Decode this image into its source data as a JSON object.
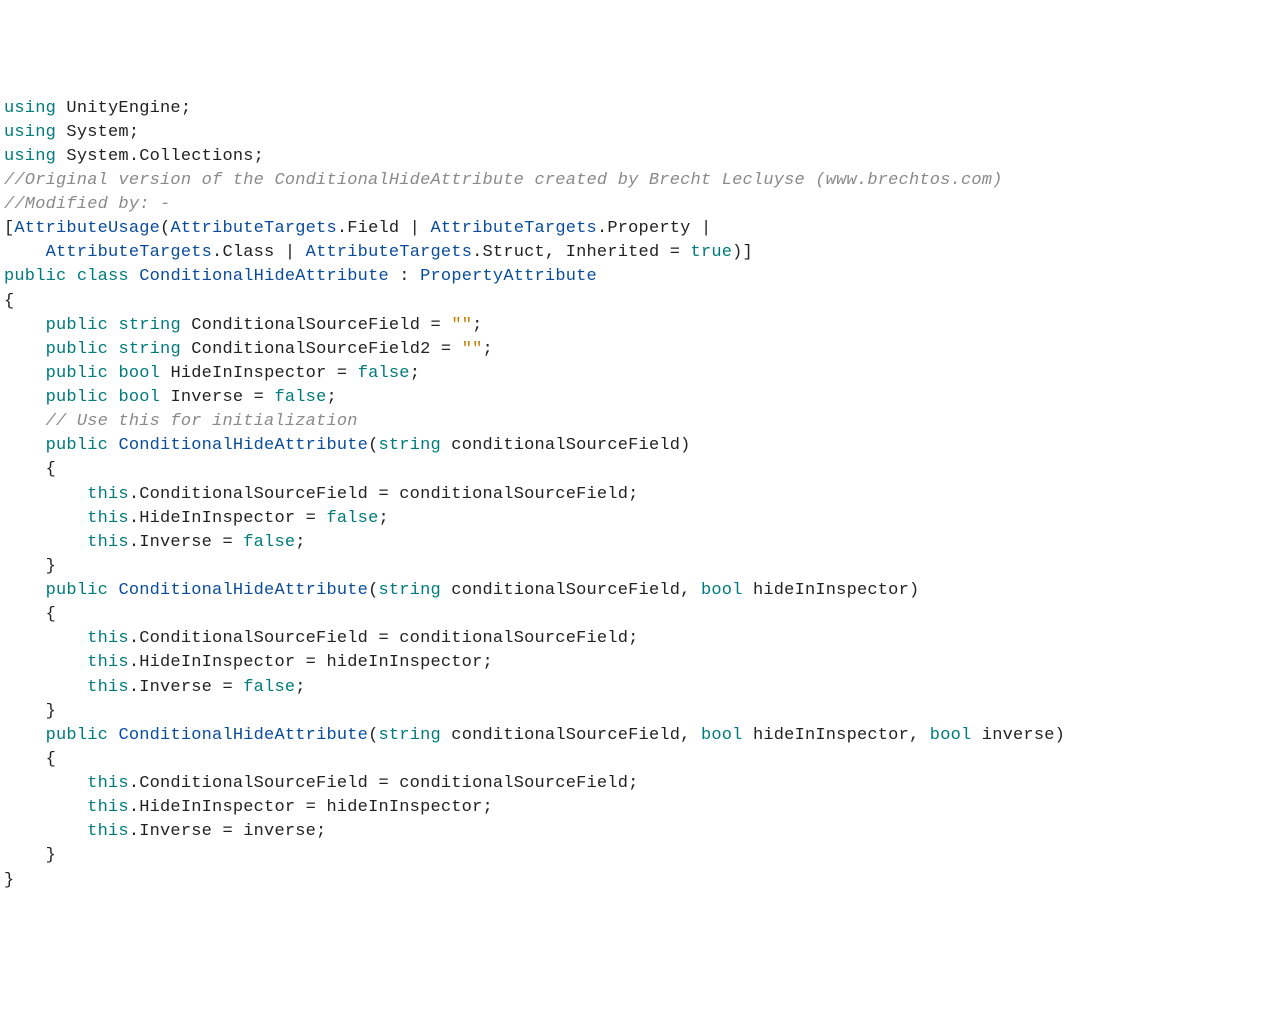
{
  "lines": [
    [
      [
        "kw",
        "using"
      ],
      [
        "ident",
        " UnityEngine;"
      ]
    ],
    [
      [
        "kw",
        "using"
      ],
      [
        "ident",
        " System;"
      ]
    ],
    [
      [
        "kw",
        "using"
      ],
      [
        "ident",
        " System.Collections;"
      ]
    ],
    [
      [
        "ident",
        ""
      ]
    ],
    [
      [
        "cmt",
        "//Original version of the ConditionalHideAttribute created by Brecht Lecluyse (www.brechtos.com)"
      ]
    ],
    [
      [
        "cmt",
        "//Modified by: -"
      ]
    ],
    [
      [
        "ident",
        ""
      ]
    ],
    [
      [
        "ident",
        "["
      ],
      [
        "type",
        "AttributeUsage"
      ],
      [
        "ident",
        "("
      ],
      [
        "type",
        "AttributeTargets"
      ],
      [
        "ident",
        ".Field | "
      ],
      [
        "type",
        "AttributeTargets"
      ],
      [
        "ident",
        ".Property | "
      ]
    ],
    [
      [
        "ident",
        "    "
      ],
      [
        "type",
        "AttributeTargets"
      ],
      [
        "ident",
        ".Class | "
      ],
      [
        "type",
        "AttributeTargets"
      ],
      [
        "ident",
        ".Struct, Inherited = "
      ],
      [
        "kw",
        "true"
      ],
      [
        "ident",
        ")]"
      ]
    ],
    [
      [
        "kw",
        "public"
      ],
      [
        "ident",
        " "
      ],
      [
        "kw",
        "class"
      ],
      [
        "ident",
        " "
      ],
      [
        "type",
        "ConditionalHideAttribute"
      ],
      [
        "ident",
        " : "
      ],
      [
        "type",
        "PropertyAttribute"
      ]
    ],
    [
      [
        "ident",
        "{"
      ]
    ],
    [
      [
        "ident",
        "    "
      ],
      [
        "kw",
        "public"
      ],
      [
        "ident",
        " "
      ],
      [
        "kw",
        "string"
      ],
      [
        "ident",
        " ConditionalSourceField = "
      ],
      [
        "str",
        "\"\""
      ],
      [
        "ident",
        ";"
      ]
    ],
    [
      [
        "ident",
        "    "
      ],
      [
        "kw",
        "public"
      ],
      [
        "ident",
        " "
      ],
      [
        "kw",
        "string"
      ],
      [
        "ident",
        " ConditionalSourceField2 = "
      ],
      [
        "str",
        "\"\""
      ],
      [
        "ident",
        ";"
      ]
    ],
    [
      [
        "ident",
        "    "
      ],
      [
        "kw",
        "public"
      ],
      [
        "ident",
        " "
      ],
      [
        "kw",
        "bool"
      ],
      [
        "ident",
        " HideInInspector = "
      ],
      [
        "kw",
        "false"
      ],
      [
        "ident",
        ";"
      ]
    ],
    [
      [
        "ident",
        "    "
      ],
      [
        "kw",
        "public"
      ],
      [
        "ident",
        " "
      ],
      [
        "kw",
        "bool"
      ],
      [
        "ident",
        " Inverse = "
      ],
      [
        "kw",
        "false"
      ],
      [
        "ident",
        ";"
      ]
    ],
    [
      [
        "ident",
        ""
      ]
    ],
    [
      [
        "ident",
        "    "
      ],
      [
        "cmt",
        "// Use this for initialization"
      ]
    ],
    [
      [
        "ident",
        "    "
      ],
      [
        "kw",
        "public"
      ],
      [
        "ident",
        " "
      ],
      [
        "type",
        "ConditionalHideAttribute"
      ],
      [
        "ident",
        "("
      ],
      [
        "kw",
        "string"
      ],
      [
        "ident",
        " conditionalSourceField)"
      ]
    ],
    [
      [
        "ident",
        "    {"
      ]
    ],
    [
      [
        "ident",
        "        "
      ],
      [
        "kw",
        "this"
      ],
      [
        "ident",
        ".ConditionalSourceField = conditionalSourceField;"
      ]
    ],
    [
      [
        "ident",
        "        "
      ],
      [
        "kw",
        "this"
      ],
      [
        "ident",
        ".HideInInspector = "
      ],
      [
        "kw",
        "false"
      ],
      [
        "ident",
        ";"
      ]
    ],
    [
      [
        "ident",
        "        "
      ],
      [
        "kw",
        "this"
      ],
      [
        "ident",
        ".Inverse = "
      ],
      [
        "kw",
        "false"
      ],
      [
        "ident",
        ";"
      ]
    ],
    [
      [
        "ident",
        "    }"
      ]
    ],
    [
      [
        "ident",
        ""
      ]
    ],
    [
      [
        "ident",
        "    "
      ],
      [
        "kw",
        "public"
      ],
      [
        "ident",
        " "
      ],
      [
        "type",
        "ConditionalHideAttribute"
      ],
      [
        "ident",
        "("
      ],
      [
        "kw",
        "string"
      ],
      [
        "ident",
        " conditionalSourceField, "
      ],
      [
        "kw",
        "bool"
      ],
      [
        "ident",
        " hideInInspector)"
      ]
    ],
    [
      [
        "ident",
        "    {"
      ]
    ],
    [
      [
        "ident",
        "        "
      ],
      [
        "kw",
        "this"
      ],
      [
        "ident",
        ".ConditionalSourceField = conditionalSourceField;"
      ]
    ],
    [
      [
        "ident",
        "        "
      ],
      [
        "kw",
        "this"
      ],
      [
        "ident",
        ".HideInInspector = hideInInspector;"
      ]
    ],
    [
      [
        "ident",
        "        "
      ],
      [
        "kw",
        "this"
      ],
      [
        "ident",
        ".Inverse = "
      ],
      [
        "kw",
        "false"
      ],
      [
        "ident",
        ";"
      ]
    ],
    [
      [
        "ident",
        "    }"
      ]
    ],
    [
      [
        "ident",
        ""
      ]
    ],
    [
      [
        "ident",
        "    "
      ],
      [
        "kw",
        "public"
      ],
      [
        "ident",
        " "
      ],
      [
        "type",
        "ConditionalHideAttribute"
      ],
      [
        "ident",
        "("
      ],
      [
        "kw",
        "string"
      ],
      [
        "ident",
        " conditionalSourceField, "
      ],
      [
        "kw",
        "bool"
      ],
      [
        "ident",
        " hideInInspector, "
      ],
      [
        "kw",
        "bool"
      ],
      [
        "ident",
        " inverse)"
      ]
    ],
    [
      [
        "ident",
        "    {"
      ]
    ],
    [
      [
        "ident",
        "        "
      ],
      [
        "kw",
        "this"
      ],
      [
        "ident",
        ".ConditionalSourceField = conditionalSourceField;"
      ]
    ],
    [
      [
        "ident",
        "        "
      ],
      [
        "kw",
        "this"
      ],
      [
        "ident",
        ".HideInInspector = hideInInspector;"
      ]
    ],
    [
      [
        "ident",
        "        "
      ],
      [
        "kw",
        "this"
      ],
      [
        "ident",
        ".Inverse = inverse;"
      ]
    ],
    [
      [
        "ident",
        "    }"
      ]
    ],
    [
      [
        "ident",
        ""
      ]
    ],
    [
      [
        "ident",
        "}"
      ]
    ]
  ]
}
